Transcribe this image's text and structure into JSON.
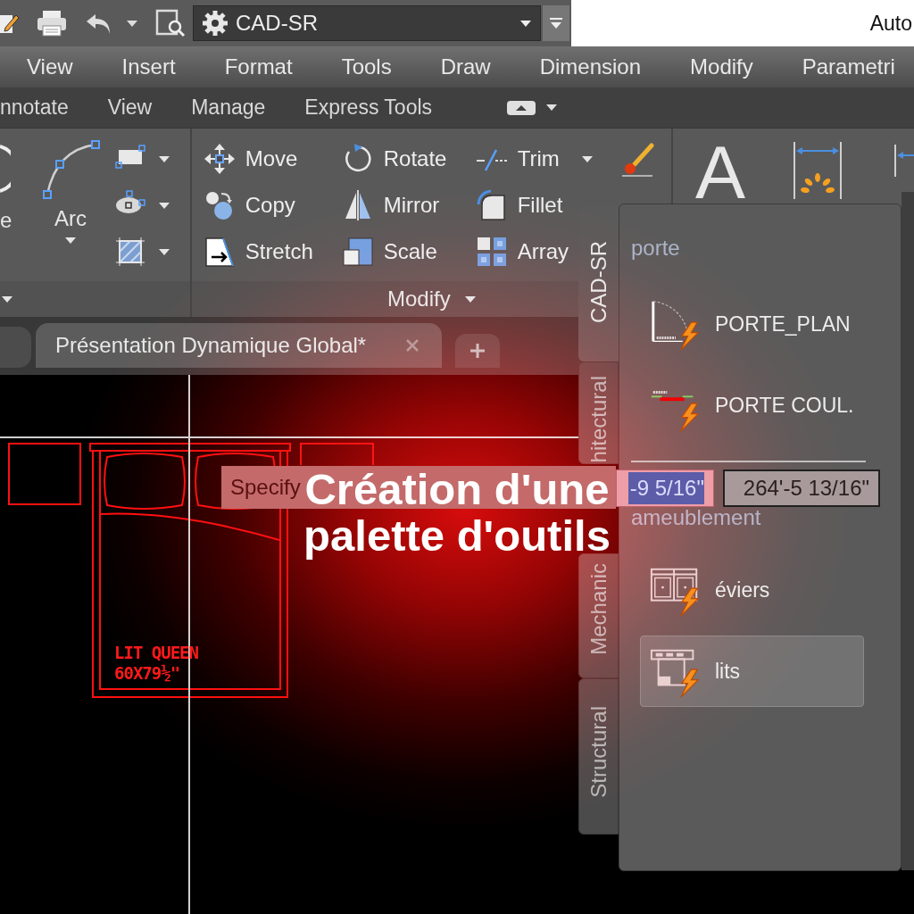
{
  "quick_access_toolbar": {
    "workspace": "CAD-SR"
  },
  "title_bar": {
    "title": "Auto"
  },
  "menu_bar": [
    "View",
    "Insert",
    "Format",
    "Tools",
    "Draw",
    "Dimension",
    "Modify",
    "Parametri"
  ],
  "ribbon_tabs": [
    {
      "label": "nnotate",
      "selected": false
    },
    {
      "label": "View",
      "selected": false
    },
    {
      "label": "Manage",
      "selected": false
    },
    {
      "label": "Express Tools",
      "selected": false
    }
  ],
  "ribbon": {
    "draw_panel": {
      "tools": [
        "e",
        "Arc"
      ]
    },
    "modify_panel": {
      "title": "Modify",
      "tools": [
        {
          "label": "Move",
          "dropdown": false
        },
        {
          "label": "Rotate",
          "dropdown": false
        },
        {
          "label": "Trim",
          "dropdown": true
        },
        {
          "label": "Copy",
          "dropdown": false
        },
        {
          "label": "Mirror",
          "dropdown": false
        },
        {
          "label": "Fillet",
          "dropdown": false
        },
        {
          "label": "Stretch",
          "dropdown": false
        },
        {
          "label": "Scale",
          "dropdown": false
        },
        {
          "label": "Array",
          "dropdown": false
        }
      ]
    },
    "annotation_panel": {
      "text_tool": "A"
    }
  },
  "file_tabs": [
    {
      "label": "Présentation Dynamique Global*",
      "selected": true
    }
  ],
  "drawing": {
    "bed_label": [
      "LIT QUEEN",
      "60X79½\""
    ],
    "tooltip": "Specify",
    "dynamic_input": [
      {
        "value": "-9 5/16\"",
        "selected": true
      },
      {
        "value": "264'-5 13/16\"",
        "selected": false
      }
    ]
  },
  "tool_palette": {
    "tabs": [
      {
        "label": "CAD-SR",
        "selected": true
      },
      {
        "label": "hitectural",
        "selected": false
      },
      {
        "label": "Mechanic",
        "selected": false
      },
      {
        "label": "Structural",
        "selected": false
      }
    ],
    "sections": [
      {
        "title": "porte",
        "items": [
          {
            "label": "PORTE_PLAN",
            "selected": false
          },
          {
            "label": "PORTE COUL.",
            "selected": false
          }
        ]
      },
      {
        "title": "ameublement",
        "items": [
          {
            "label": "éviers",
            "selected": false
          },
          {
            "label": "lits",
            "selected": true
          }
        ]
      }
    ]
  },
  "overlay_title": "Création d'une palette d'outils"
}
